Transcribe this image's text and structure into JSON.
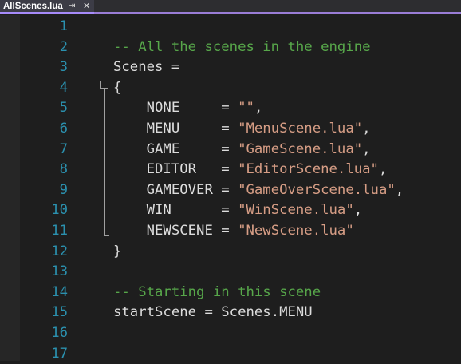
{
  "tab": {
    "title": "AllScenes.lua",
    "pin_icon": "pin-icon",
    "close_icon": "close-icon"
  },
  "colors": {
    "background": "#1e1e1e",
    "line_number": "#2b91af",
    "comment": "#57a64a",
    "string": "#d69d85",
    "identifier": "#dcdcdc",
    "tab_accent": "#a78bfa"
  },
  "lines": [
    {
      "num": "1",
      "parts": []
    },
    {
      "num": "2",
      "parts": [
        {
          "t": "-- All the scenes in the engine",
          "k": "comment"
        }
      ]
    },
    {
      "num": "3",
      "parts": [
        {
          "t": "Scenes =",
          "k": "ident"
        }
      ]
    },
    {
      "num": "4",
      "parts": [
        {
          "t": "{",
          "k": "ident"
        }
      ]
    },
    {
      "num": "5",
      "parts": [
        {
          "t": "    NONE     = ",
          "k": "ident"
        },
        {
          "t": "\"\"",
          "k": "str"
        },
        {
          "t": ",",
          "k": "ident"
        }
      ]
    },
    {
      "num": "6",
      "parts": [
        {
          "t": "    MENU     = ",
          "k": "ident"
        },
        {
          "t": "\"MenuScene.lua\"",
          "k": "str"
        },
        {
          "t": ",",
          "k": "ident"
        }
      ]
    },
    {
      "num": "7",
      "parts": [
        {
          "t": "    GAME     = ",
          "k": "ident"
        },
        {
          "t": "\"GameScene.lua\"",
          "k": "str"
        },
        {
          "t": ",",
          "k": "ident"
        }
      ]
    },
    {
      "num": "8",
      "parts": [
        {
          "t": "    EDITOR   = ",
          "k": "ident"
        },
        {
          "t": "\"EditorScene.lua\"",
          "k": "str"
        },
        {
          "t": ",",
          "k": "ident"
        }
      ]
    },
    {
      "num": "9",
      "parts": [
        {
          "t": "    GAMEOVER = ",
          "k": "ident"
        },
        {
          "t": "\"GameOverScene.lua\"",
          "k": "str"
        },
        {
          "t": ",",
          "k": "ident"
        }
      ]
    },
    {
      "num": "10",
      "parts": [
        {
          "t": "    WIN      = ",
          "k": "ident"
        },
        {
          "t": "\"WinScene.lua\"",
          "k": "str"
        },
        {
          "t": ",",
          "k": "ident"
        }
      ]
    },
    {
      "num": "11",
      "parts": [
        {
          "t": "    NEWSCENE = ",
          "k": "ident"
        },
        {
          "t": "\"NewScene.lua\"",
          "k": "str"
        }
      ]
    },
    {
      "num": "12",
      "parts": [
        {
          "t": "}",
          "k": "ident"
        }
      ]
    },
    {
      "num": "13",
      "parts": []
    },
    {
      "num": "14",
      "parts": [
        {
          "t": "-- Starting in this scene",
          "k": "comment"
        }
      ]
    },
    {
      "num": "15",
      "parts": [
        {
          "t": "startScene = Scenes.MENU",
          "k": "ident"
        }
      ]
    },
    {
      "num": "16",
      "parts": []
    },
    {
      "num": "17",
      "parts": []
    }
  ]
}
